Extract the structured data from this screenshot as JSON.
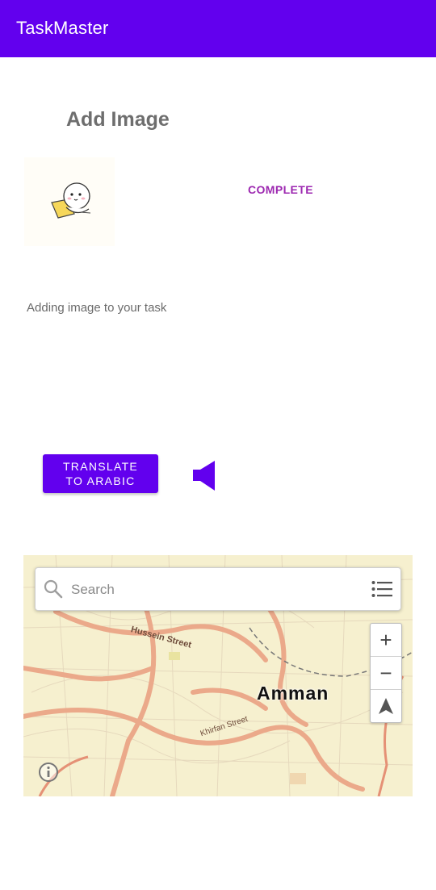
{
  "app": {
    "title": "TaskMaster",
    "bar_color": "#6200EE"
  },
  "detail": {
    "heading": "Add Image",
    "status": "COMPLETE",
    "description": "Adding image to your task"
  },
  "actions": {
    "translate_line1": "TRANSLATE",
    "translate_line2": "TO ARABIC",
    "speak_icon": "speaker-icon"
  },
  "map": {
    "search_placeholder": "Search",
    "city": "Amman",
    "streets": [
      "Hussein Street",
      "Khirfan Street"
    ],
    "controls": {
      "zoom_in": "+",
      "zoom_out": "−"
    }
  }
}
